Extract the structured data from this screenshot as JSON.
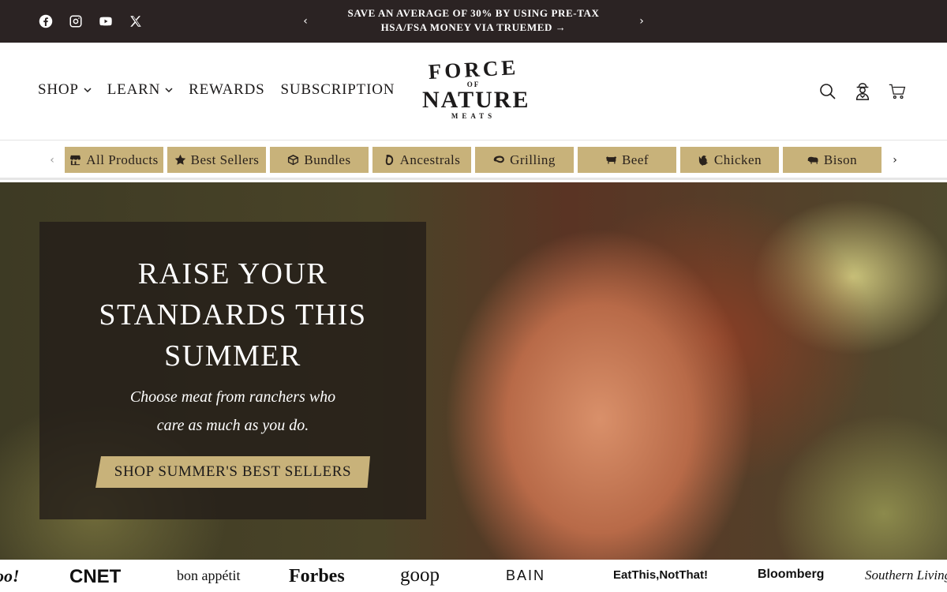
{
  "announcement": {
    "text": "SAVE AN AVERAGE OF 30% BY USING PRE-TAX HSA/FSA MONEY VIA TRUEMED →",
    "prev_arrow": "‹",
    "next_arrow": "›"
  },
  "social": [
    "facebook-icon",
    "instagram-icon",
    "youtube-icon",
    "x-icon"
  ],
  "nav": {
    "shop": "SHOP",
    "learn": "LEARN",
    "rewards": "REWARDS",
    "subscription": "SUBSCRIPTION"
  },
  "logo": {
    "force": "FORCE",
    "of": "OF",
    "nature": "NATURE",
    "meats": "MEATS"
  },
  "header_icons": [
    "search-icon",
    "account-icon",
    "cart-icon"
  ],
  "categories": [
    {
      "label": "All Products",
      "icon": "store-icon"
    },
    {
      "label": "Best Sellers",
      "icon": "star-icon"
    },
    {
      "label": "Bundles",
      "icon": "box-icon"
    },
    {
      "label": "Ancestrals",
      "icon": "organ-icon"
    },
    {
      "label": "Grilling",
      "icon": "steak-icon"
    },
    {
      "label": "Beef",
      "icon": "cow-icon"
    },
    {
      "label": "Chicken",
      "icon": "chicken-icon"
    },
    {
      "label": "Bison",
      "icon": "bison-icon"
    }
  ],
  "catbar": {
    "prev": "‹",
    "next": "›"
  },
  "hero": {
    "title_line1": "RAISE YOUR",
    "title_line2": "STANDARDS THIS",
    "title_line3": "SUMMER",
    "sub_line1": "Choose meat from ranchers who",
    "sub_line2": "care as much as you do.",
    "cta": "SHOP SUMMER'S BEST SELLERS"
  },
  "press": [
    "oo!",
    "CNET",
    "bon appétit",
    "Forbes",
    "goop",
    "BAIN",
    "EatThis,NotThat!",
    "Bloomberg",
    "Southern Living"
  ],
  "colors": {
    "announcement_bg": "#2b2323",
    "accent_gold": "#c8b27a",
    "text_dark": "#1c1a1a"
  }
}
